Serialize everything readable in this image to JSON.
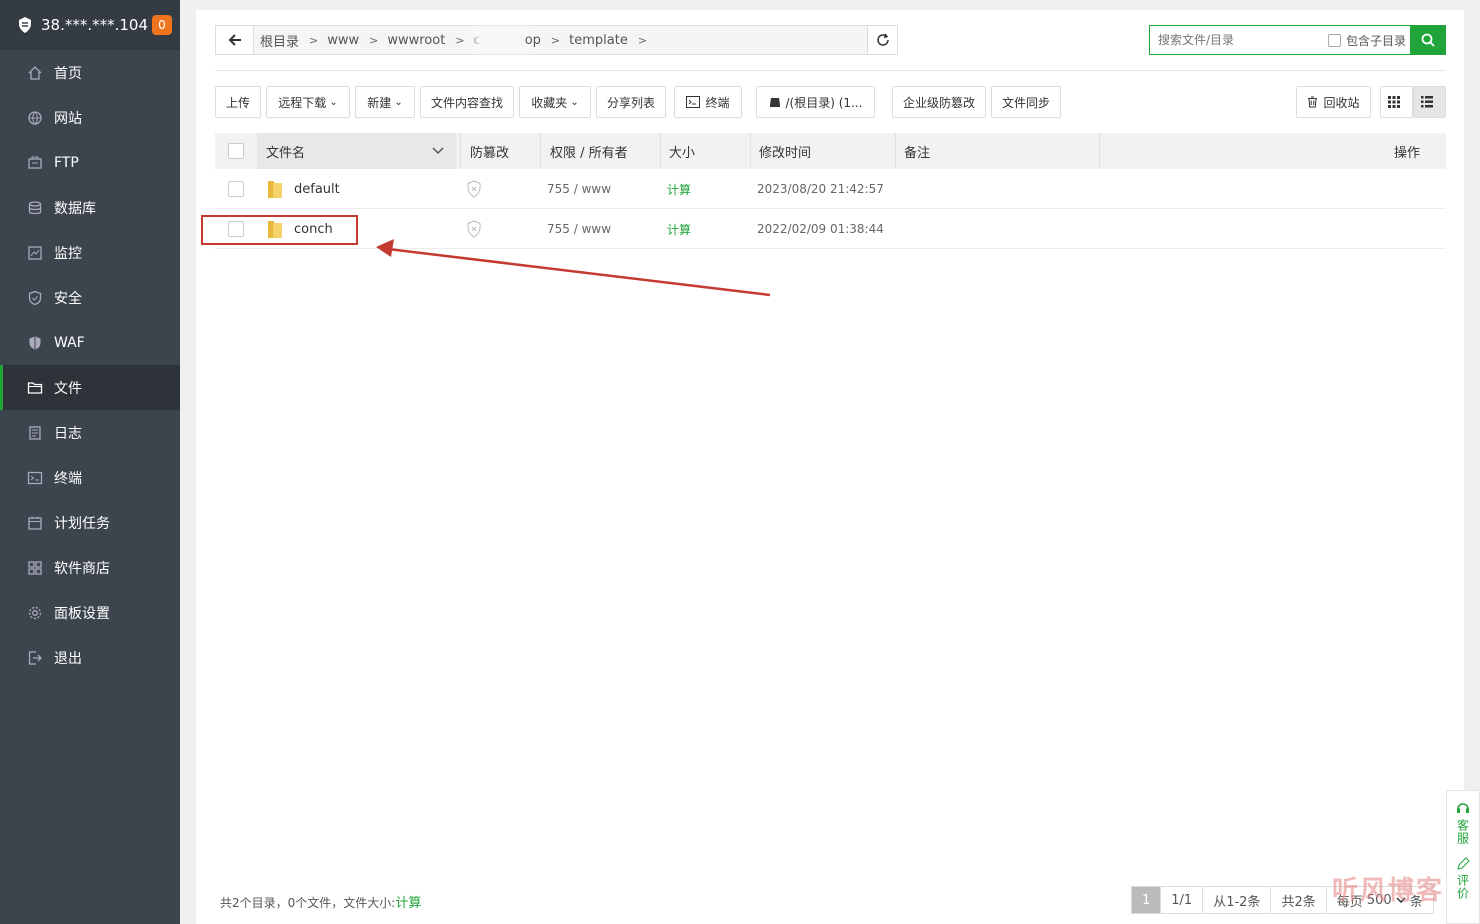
{
  "sidebar": {
    "server_ip": "38.***.***.104",
    "badge": "0",
    "items": [
      {
        "label": "首页",
        "icon": "home-icon"
      },
      {
        "label": "网站",
        "icon": "globe-icon"
      },
      {
        "label": "FTP",
        "icon": "ftp-icon"
      },
      {
        "label": "数据库",
        "icon": "database-icon"
      },
      {
        "label": "监控",
        "icon": "monitor-icon"
      },
      {
        "label": "安全",
        "icon": "shield-icon"
      },
      {
        "label": "WAF",
        "icon": "waf-shield-icon"
      },
      {
        "label": "文件",
        "icon": "folder-icon"
      },
      {
        "label": "日志",
        "icon": "log-icon"
      },
      {
        "label": "终端",
        "icon": "terminal-icon"
      },
      {
        "label": "计划任务",
        "icon": "calendar-icon"
      },
      {
        "label": "软件商店",
        "icon": "apps-icon"
      },
      {
        "label": "面板设置",
        "icon": "gear-icon"
      },
      {
        "label": "退出",
        "icon": "logout-icon"
      }
    ],
    "active_index": 7
  },
  "path": {
    "crumbs": [
      "根目录",
      "www",
      "wwwroot",
      "c",
      "op",
      "template"
    ]
  },
  "search": {
    "placeholder": "搜索文件/目录",
    "subdir_label": "包含子目录"
  },
  "toolbar": {
    "upload": "上传",
    "remote_download": "远程下载",
    "new": "新建",
    "content_search": "文件内容查找",
    "favorites": "收藏夹",
    "share_list": "分享列表",
    "terminal": "终端",
    "disk": "/(根目录) (1...",
    "tamper": "企业级防篡改",
    "sync": "文件同步",
    "recycle": "回收站"
  },
  "table": {
    "headers": {
      "name": "文件名",
      "tamper": "防篡改",
      "perm": "权限 / 所有者",
      "size": "大小",
      "mtime": "修改时间",
      "note": "备注",
      "ops": "操作"
    },
    "rows": [
      {
        "name": "default",
        "perm": "755 / www",
        "size": "计算",
        "mtime": "2023/08/20 21:42:57"
      },
      {
        "name": "conch",
        "perm": "755 / www",
        "size": "计算",
        "mtime": "2022/02/09 01:38:44"
      }
    ]
  },
  "footer": {
    "summary": "共2个目录，0个文件，文件大小:",
    "calc": "计算",
    "page_current": "1",
    "page_total": "1/1",
    "range": "从1-2条",
    "total": "共2条",
    "per_page_label": "每页",
    "per_page_value": "500",
    "per_page_unit": "条"
  },
  "float": {
    "service": "客服",
    "review": "评价"
  },
  "watermark": "听风博客",
  "colors": {
    "accent": "#20a53a",
    "sidebar_bg": "#3c444d",
    "badge": "#f0731d",
    "annotation": "#c43a31"
  }
}
